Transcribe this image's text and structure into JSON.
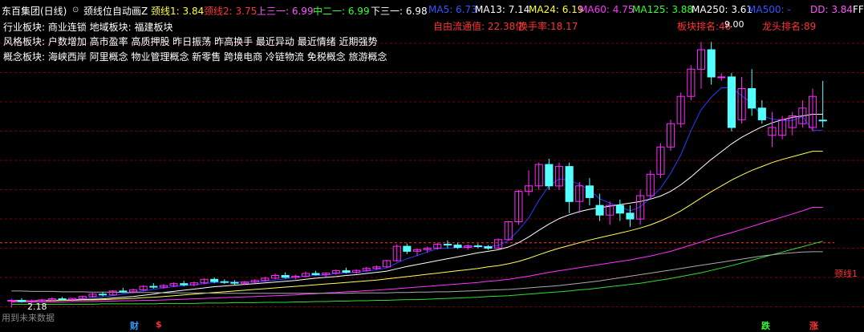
{
  "header": {
    "stock_name": "东百集团(日线)",
    "indicator_name": "颈线位自动画Z",
    "neck1": "颈线1: 3.84",
    "neck2": "颈线2: 3.75",
    "up3": "上三一: 6.99",
    "mid2": "中二一: 6.99",
    "down3": "下三一: 6.98",
    "ma5": "MA5: 6.73",
    "ma13": "MA13: 7.14",
    "ma24": "MA24: 6.19",
    "ma60": "MA60: 4.75",
    "ma125": "MA125: 3.88",
    "ma250": "MA250: 3.61",
    "ma500": "MA500: -",
    "dd": "DD: 3.84",
    "ff": "FF"
  },
  "stats": {
    "float_cap": "自由流通值: 22.38亿",
    "turnover": "换手率:18.17",
    "board_rank": "板块排名:46",
    "leader_rank": "龙头排名:89"
  },
  "boards": {
    "industry": "行业板块: 商业连锁  地域板块: 福建板块",
    "style": "风格板块: 户数增加 高市盈率 高质押股 昨日振荡 昨高换手 最近异动 最近情绪 近期强势",
    "concept": "概念板块: 海峡西岸 阿里概念 物业管理概念 新零售 跨境电商 冷链物流 免税概念 旅游概念"
  },
  "annotations": {
    "high_price": "9.00",
    "low_price": "2.18",
    "neckline_label": "颈线1",
    "future_data": "用到未来数据"
  },
  "footer_tags": {
    "cai": "财",
    "dollar": "$",
    "die": "跌",
    "zhang": "涨"
  },
  "colors": {
    "up": "#ff2aff",
    "down": "#54ffff",
    "ma5": "#2a3cff",
    "ma13": "#ffffff",
    "ma24": "#ffff55",
    "ma60": "#ff33ff",
    "ma125": "#33dd33",
    "ma250": "#aaaaaa",
    "grid": "#7a0000",
    "neckline": "#ff3333"
  },
  "chart_data": {
    "type": "candlestick",
    "ylim": [
      2.0,
      9.5
    ],
    "neckline": 3.84,
    "candles": [
      {
        "o": 2.34,
        "h": 2.4,
        "l": 2.18,
        "c": 2.36
      },
      {
        "o": 2.36,
        "h": 2.42,
        "l": 2.3,
        "c": 2.33
      },
      {
        "o": 2.33,
        "h": 2.38,
        "l": 2.28,
        "c": 2.35
      },
      {
        "o": 2.35,
        "h": 2.4,
        "l": 2.3,
        "c": 2.37
      },
      {
        "o": 2.37,
        "h": 2.44,
        "l": 2.34,
        "c": 2.4
      },
      {
        "o": 2.4,
        "h": 2.45,
        "l": 2.35,
        "c": 2.38
      },
      {
        "o": 2.38,
        "h": 2.42,
        "l": 2.34,
        "c": 2.41
      },
      {
        "o": 2.41,
        "h": 2.48,
        "l": 2.39,
        "c": 2.46
      },
      {
        "o": 2.46,
        "h": 2.55,
        "l": 2.44,
        "c": 2.52
      },
      {
        "o": 2.52,
        "h": 2.58,
        "l": 2.46,
        "c": 2.5
      },
      {
        "o": 2.5,
        "h": 2.62,
        "l": 2.48,
        "c": 2.6
      },
      {
        "o": 2.6,
        "h": 2.68,
        "l": 2.55,
        "c": 2.58
      },
      {
        "o": 2.58,
        "h": 2.66,
        "l": 2.54,
        "c": 2.63
      },
      {
        "o": 2.63,
        "h": 2.75,
        "l": 2.6,
        "c": 2.72
      },
      {
        "o": 2.72,
        "h": 2.8,
        "l": 2.66,
        "c": 2.7
      },
      {
        "o": 2.7,
        "h": 2.78,
        "l": 2.66,
        "c": 2.74
      },
      {
        "o": 2.74,
        "h": 2.82,
        "l": 2.7,
        "c": 2.79
      },
      {
        "o": 2.79,
        "h": 2.86,
        "l": 2.72,
        "c": 2.76
      },
      {
        "o": 2.76,
        "h": 2.84,
        "l": 2.72,
        "c": 2.81
      },
      {
        "o": 2.81,
        "h": 2.92,
        "l": 2.78,
        "c": 2.9
      },
      {
        "o": 2.9,
        "h": 2.95,
        "l": 2.8,
        "c": 2.84
      },
      {
        "o": 2.84,
        "h": 2.9,
        "l": 2.78,
        "c": 2.82
      },
      {
        "o": 2.82,
        "h": 2.88,
        "l": 2.76,
        "c": 2.8
      },
      {
        "o": 2.8,
        "h": 2.86,
        "l": 2.75,
        "c": 2.83
      },
      {
        "o": 2.83,
        "h": 2.9,
        "l": 2.79,
        "c": 2.87
      },
      {
        "o": 2.87,
        "h": 2.96,
        "l": 2.84,
        "c": 2.93
      },
      {
        "o": 2.93,
        "h": 3.05,
        "l": 2.9,
        "c": 3.0
      },
      {
        "o": 3.0,
        "h": 3.08,
        "l": 2.92,
        "c": 2.95
      },
      {
        "o": 2.95,
        "h": 3.02,
        "l": 2.9,
        "c": 2.98
      },
      {
        "o": 2.98,
        "h": 3.1,
        "l": 2.95,
        "c": 3.05
      },
      {
        "o": 3.05,
        "h": 3.12,
        "l": 3.0,
        "c": 3.02
      },
      {
        "o": 3.02,
        "h": 3.08,
        "l": 2.96,
        "c": 3.06
      },
      {
        "o": 3.06,
        "h": 3.15,
        "l": 3.02,
        "c": 3.12
      },
      {
        "o": 3.12,
        "h": 3.2,
        "l": 3.05,
        "c": 3.08
      },
      {
        "o": 3.08,
        "h": 3.16,
        "l": 3.04,
        "c": 3.13
      },
      {
        "o": 3.13,
        "h": 3.22,
        "l": 3.1,
        "c": 3.18
      },
      {
        "o": 3.18,
        "h": 3.26,
        "l": 3.14,
        "c": 3.22
      },
      {
        "o": 3.22,
        "h": 3.4,
        "l": 3.2,
        "c": 3.38
      },
      {
        "o": 3.38,
        "h": 3.8,
        "l": 3.35,
        "c": 3.75
      },
      {
        "o": 3.75,
        "h": 3.82,
        "l": 3.55,
        "c": 3.62
      },
      {
        "o": 3.62,
        "h": 3.7,
        "l": 3.5,
        "c": 3.66
      },
      {
        "o": 3.66,
        "h": 3.74,
        "l": 3.58,
        "c": 3.7
      },
      {
        "o": 3.7,
        "h": 3.84,
        "l": 3.66,
        "c": 3.8
      },
      {
        "o": 3.8,
        "h": 3.9,
        "l": 3.7,
        "c": 3.78
      },
      {
        "o": 3.78,
        "h": 3.84,
        "l": 3.68,
        "c": 3.72
      },
      {
        "o": 3.72,
        "h": 3.8,
        "l": 3.66,
        "c": 3.76
      },
      {
        "o": 3.76,
        "h": 3.82,
        "l": 3.7,
        "c": 3.74
      },
      {
        "o": 3.74,
        "h": 3.78,
        "l": 3.66,
        "c": 3.7
      },
      {
        "o": 3.7,
        "h": 3.95,
        "l": 3.68,
        "c": 3.92
      },
      {
        "o": 3.92,
        "h": 4.4,
        "l": 3.9,
        "c": 4.38
      },
      {
        "o": 4.38,
        "h": 5.2,
        "l": 4.3,
        "c": 5.16
      },
      {
        "o": 5.16,
        "h": 5.7,
        "l": 5.05,
        "c": 5.3
      },
      {
        "o": 5.3,
        "h": 5.9,
        "l": 5.2,
        "c": 5.85
      },
      {
        "o": 5.85,
        "h": 6.0,
        "l": 5.2,
        "c": 5.3
      },
      {
        "o": 5.3,
        "h": 5.9,
        "l": 5.2,
        "c": 5.8
      },
      {
        "o": 5.8,
        "h": 5.9,
        "l": 4.6,
        "c": 4.9
      },
      {
        "o": 4.9,
        "h": 5.4,
        "l": 4.6,
        "c": 5.3
      },
      {
        "o": 5.3,
        "h": 5.5,
        "l": 4.8,
        "c": 5.0
      },
      {
        "o": 4.8,
        "h": 5.1,
        "l": 4.4,
        "c": 4.55
      },
      {
        "o": 4.55,
        "h": 4.9,
        "l": 4.3,
        "c": 4.8
      },
      {
        "o": 4.8,
        "h": 4.95,
        "l": 4.4,
        "c": 4.6
      },
      {
        "o": 4.6,
        "h": 4.8,
        "l": 4.25,
        "c": 4.45
      },
      {
        "o": 4.45,
        "h": 5.2,
        "l": 4.3,
        "c": 5.05
      },
      {
        "o": 5.05,
        "h": 5.7,
        "l": 4.95,
        "c": 5.6
      },
      {
        "o": 5.6,
        "h": 6.4,
        "l": 5.5,
        "c": 6.3
      },
      {
        "o": 6.3,
        "h": 7.0,
        "l": 6.2,
        "c": 6.9
      },
      {
        "o": 6.9,
        "h": 7.7,
        "l": 6.8,
        "c": 7.6
      },
      {
        "o": 7.6,
        "h": 8.4,
        "l": 7.5,
        "c": 8.3
      },
      {
        "o": 8.3,
        "h": 9.0,
        "l": 7.8,
        "c": 8.8
      },
      {
        "o": 8.8,
        "h": 9.0,
        "l": 7.9,
        "c": 8.1
      },
      {
        "o": 8.1,
        "h": 8.2,
        "l": 8.0,
        "c": 8.1
      },
      {
        "o": 8.1,
        "h": 8.2,
        "l": 6.7,
        "c": 6.8
      },
      {
        "o": 7.0,
        "h": 8.1,
        "l": 6.9,
        "c": 7.8
      },
      {
        "o": 7.8,
        "h": 8.3,
        "l": 7.1,
        "c": 7.3
      },
      {
        "o": 7.3,
        "h": 7.5,
        "l": 6.9,
        "c": 7.0
      },
      {
        "o": 6.6,
        "h": 7.2,
        "l": 6.3,
        "c": 6.8
      },
      {
        "o": 6.6,
        "h": 7.1,
        "l": 6.5,
        "c": 7.0
      },
      {
        "o": 6.8,
        "h": 7.2,
        "l": 6.6,
        "c": 7.1
      },
      {
        "o": 6.9,
        "h": 7.5,
        "l": 6.8,
        "c": 7.3
      },
      {
        "o": 6.8,
        "h": 7.8,
        "l": 6.7,
        "c": 7.6
      },
      {
        "o": 6.99,
        "h": 8.0,
        "l": 6.8,
        "c": 6.98
      }
    ],
    "ma_lines": {
      "MA5": [
        2.36,
        2.35,
        2.35,
        2.36,
        2.36,
        2.37,
        2.38,
        2.4,
        2.43,
        2.45,
        2.48,
        2.52,
        2.56,
        2.6,
        2.64,
        2.68,
        2.71,
        2.74,
        2.76,
        2.79,
        2.82,
        2.83,
        2.83,
        2.83,
        2.83,
        2.85,
        2.88,
        2.91,
        2.95,
        2.98,
        3.0,
        3.01,
        3.05,
        3.07,
        3.08,
        3.11,
        3.15,
        3.19,
        3.32,
        3.43,
        3.51,
        3.6,
        3.69,
        3.7,
        3.71,
        3.74,
        3.76,
        3.74,
        3.77,
        3.9,
        4.16,
        4.48,
        4.93,
        5.3,
        5.48,
        5.45,
        5.34,
        5.2,
        4.97,
        4.86,
        4.76,
        4.66,
        4.76,
        4.99,
        5.24,
        5.62,
        6.1,
        6.72,
        7.26,
        7.58,
        7.82,
        7.82,
        7.62,
        7.42,
        7.1,
        7.02,
        6.98,
        6.98,
        7.08,
        6.73,
        6.73
      ],
      "MA13": [
        2.36,
        2.35,
        2.35,
        2.35,
        2.36,
        2.36,
        2.37,
        2.38,
        2.39,
        2.4,
        2.42,
        2.44,
        2.46,
        2.49,
        2.52,
        2.56,
        2.59,
        2.62,
        2.65,
        2.68,
        2.71,
        2.73,
        2.75,
        2.77,
        2.79,
        2.81,
        2.83,
        2.85,
        2.87,
        2.9,
        2.93,
        2.95,
        2.97,
        3.0,
        3.02,
        3.05,
        3.08,
        3.11,
        3.17,
        3.23,
        3.28,
        3.33,
        3.38,
        3.43,
        3.48,
        3.53,
        3.58,
        3.62,
        3.66,
        3.73,
        3.84,
        3.99,
        4.16,
        4.32,
        4.46,
        4.56,
        4.64,
        4.7,
        4.74,
        4.78,
        4.82,
        4.86,
        4.9,
        4.96,
        5.04,
        5.16,
        5.33,
        5.53,
        5.76,
        5.98,
        6.18,
        6.38,
        6.55,
        6.69,
        6.82,
        6.92,
        7.0,
        7.06,
        7.1,
        7.14,
        7.14
      ],
      "MA24": [
        2.35,
        2.35,
        2.35,
        2.35,
        2.35,
        2.36,
        2.36,
        2.37,
        2.37,
        2.38,
        2.39,
        2.4,
        2.41,
        2.43,
        2.44,
        2.46,
        2.48,
        2.5,
        2.52,
        2.54,
        2.56,
        2.58,
        2.6,
        2.62,
        2.64,
        2.66,
        2.68,
        2.7,
        2.72,
        2.74,
        2.76,
        2.78,
        2.8,
        2.82,
        2.84,
        2.86,
        2.88,
        2.91,
        2.94,
        2.97,
        3.0,
        3.03,
        3.06,
        3.09,
        3.12,
        3.15,
        3.18,
        3.22,
        3.25,
        3.3,
        3.36,
        3.44,
        3.53,
        3.62,
        3.7,
        3.77,
        3.84,
        3.91,
        3.97,
        4.03,
        4.09,
        4.15,
        4.22,
        4.3,
        4.4,
        4.52,
        4.66,
        4.82,
        4.99,
        5.15,
        5.3,
        5.45,
        5.58,
        5.7,
        5.8,
        5.9,
        5.98,
        6.05,
        6.12,
        6.19,
        6.19
      ],
      "MA60": [
        2.32,
        2.32,
        2.32,
        2.32,
        2.32,
        2.32,
        2.33,
        2.33,
        2.33,
        2.34,
        2.34,
        2.35,
        2.35,
        2.36,
        2.36,
        2.37,
        2.38,
        2.39,
        2.4,
        2.41,
        2.42,
        2.43,
        2.44,
        2.45,
        2.46,
        2.47,
        2.48,
        2.49,
        2.5,
        2.52,
        2.53,
        2.55,
        2.56,
        2.58,
        2.59,
        2.61,
        2.62,
        2.64,
        2.66,
        2.68,
        2.7,
        2.72,
        2.74,
        2.76,
        2.78,
        2.8,
        2.82,
        2.85,
        2.87,
        2.9,
        2.94,
        2.98,
        3.03,
        3.08,
        3.12,
        3.16,
        3.2,
        3.24,
        3.28,
        3.32,
        3.36,
        3.4,
        3.45,
        3.5,
        3.56,
        3.62,
        3.7,
        3.78,
        3.86,
        3.95,
        4.03,
        4.1,
        4.18,
        4.26,
        4.34,
        4.42,
        4.5,
        4.58,
        4.66,
        4.75,
        4.75
      ],
      "MA125": [
        2.26,
        2.26,
        2.26,
        2.26,
        2.26,
        2.26,
        2.26,
        2.26,
        2.26,
        2.27,
        2.27,
        2.27,
        2.27,
        2.27,
        2.27,
        2.28,
        2.28,
        2.28,
        2.28,
        2.29,
        2.29,
        2.29,
        2.3,
        2.3,
        2.3,
        2.31,
        2.31,
        2.31,
        2.32,
        2.32,
        2.33,
        2.33,
        2.34,
        2.34,
        2.35,
        2.35,
        2.36,
        2.36,
        2.37,
        2.38,
        2.38,
        2.39,
        2.4,
        2.41,
        2.42,
        2.43,
        2.44,
        2.46,
        2.47,
        2.48,
        2.5,
        2.52,
        2.54,
        2.56,
        2.58,
        2.6,
        2.63,
        2.65,
        2.68,
        2.71,
        2.74,
        2.77,
        2.8,
        2.84,
        2.88,
        2.92,
        2.97,
        3.02,
        3.07,
        3.13,
        3.19,
        3.25,
        3.32,
        3.39,
        3.46,
        3.53,
        3.6,
        3.67,
        3.74,
        3.81,
        3.88
      ],
      "MA250": [
        2.6,
        2.6,
        2.59,
        2.59,
        2.59,
        2.58,
        2.58,
        2.58,
        2.57,
        2.57,
        2.57,
        2.56,
        2.56,
        2.56,
        2.56,
        2.55,
        2.55,
        2.55,
        2.55,
        2.55,
        2.54,
        2.54,
        2.54,
        2.54,
        2.54,
        2.54,
        2.54,
        2.54,
        2.54,
        2.54,
        2.54,
        2.54,
        2.54,
        2.54,
        2.55,
        2.55,
        2.55,
        2.55,
        2.56,
        2.56,
        2.57,
        2.57,
        2.58,
        2.58,
        2.59,
        2.6,
        2.61,
        2.62,
        2.63,
        2.64,
        2.66,
        2.68,
        2.7,
        2.72,
        2.74,
        2.77,
        2.8,
        2.83,
        2.86,
        2.9,
        2.94,
        2.98,
        3.02,
        3.06,
        3.1,
        3.14,
        3.18,
        3.22,
        3.26,
        3.3,
        3.34,
        3.38,
        3.42,
        3.46,
        3.5,
        3.53,
        3.56,
        3.58,
        3.6,
        3.61,
        3.61
      ]
    }
  }
}
